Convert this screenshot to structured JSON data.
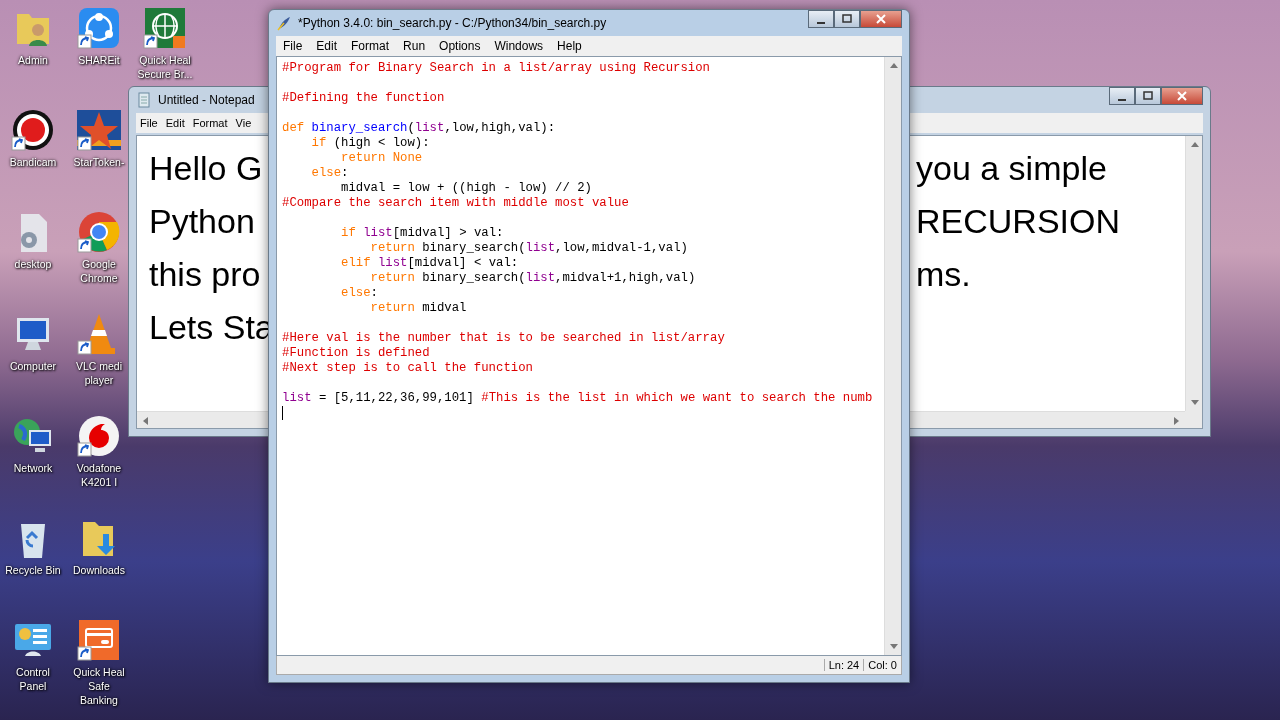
{
  "desktop_icons": [
    {
      "label": "Admin",
      "kind": "user-folder",
      "shortcut": false
    },
    {
      "label": "Bandicam",
      "kind": "record",
      "shortcut": true
    },
    {
      "label": "desktop",
      "kind": "document",
      "shortcut": false
    },
    {
      "label": "Computer",
      "kind": "computer",
      "shortcut": false
    },
    {
      "label": "Network",
      "kind": "network",
      "shortcut": false
    },
    {
      "label": "Recycle Bin",
      "kind": "recycle",
      "shortcut": false
    },
    {
      "label": "Control Panel",
      "kind": "control-panel",
      "shortcut": false
    },
    {
      "label": "SHAREit",
      "kind": "share",
      "shortcut": true
    },
    {
      "label": "StarToken-",
      "kind": "star",
      "shortcut": true
    },
    {
      "label": "Google Chrome",
      "kind": "browser",
      "shortcut": true
    },
    {
      "label": "VLC medi player",
      "kind": "cone",
      "shortcut": true
    },
    {
      "label": "Vodafone K4201 I",
      "kind": "vodafone",
      "shortcut": true
    },
    {
      "label": "Downloads",
      "kind": "download-folder",
      "shortcut": false
    },
    {
      "label": "Quick Heal Safe Banking",
      "kind": "card",
      "shortcut": true
    },
    {
      "label": "Quick Heal Secure Br...",
      "kind": "globe",
      "shortcut": true
    }
  ],
  "notepad": {
    "title": "Untitled - Notepad",
    "menu": [
      "File",
      "Edit",
      "Format",
      "Vie"
    ],
    "text_left": [
      "Hello G",
      "Python",
      "this pro",
      "Lets Sta"
    ],
    "text_right": [
      "you a simple",
      "RECURSION",
      "ms."
    ]
  },
  "editor": {
    "title": "*Python 3.4.0: bin_search.py - C:/Python34/bin_search.py",
    "menu": [
      "File",
      "Edit",
      "Format",
      "Run",
      "Options",
      "Windows",
      "Help"
    ],
    "lines": [
      {
        "kind": "code",
        "tokens": [
          {
            "kind": "comment",
            "text": "#Program for Binary Search in a list/array using Recursion"
          }
        ]
      },
      {
        "kind": "blank"
      },
      {
        "kind": "code",
        "tokens": [
          {
            "kind": "comment",
            "text": "#Defining the function"
          }
        ]
      },
      {
        "kind": "blank"
      },
      {
        "kind": "code",
        "tokens": [
          {
            "kind": "keyword",
            "text": "def "
          },
          {
            "kind": "definition",
            "text": "binary_search"
          },
          {
            "kind": "plain",
            "text": "("
          },
          {
            "kind": "builtin",
            "text": "list"
          },
          {
            "kind": "plain",
            "text": ",low,high,val):"
          }
        ]
      },
      {
        "kind": "code",
        "tokens": [
          {
            "kind": "keyword",
            "text": "    if"
          },
          {
            "kind": "plain",
            "text": " (high < low):"
          }
        ]
      },
      {
        "kind": "code",
        "tokens": [
          {
            "kind": "keyword",
            "text": "        return None"
          }
        ]
      },
      {
        "kind": "code",
        "tokens": [
          {
            "kind": "keyword",
            "text": "    else"
          },
          {
            "kind": "plain",
            "text": ":"
          }
        ]
      },
      {
        "kind": "code",
        "tokens": [
          {
            "kind": "plain",
            "text": "        midval = low + ((high - low) // 2)"
          }
        ]
      },
      {
        "kind": "code",
        "tokens": [
          {
            "kind": "comment",
            "text": "#Compare the search item with middle most value"
          }
        ]
      },
      {
        "kind": "blank"
      },
      {
        "kind": "code",
        "tokens": [
          {
            "kind": "keyword",
            "text": "        if "
          },
          {
            "kind": "builtin",
            "text": "list"
          },
          {
            "kind": "plain",
            "text": "[midval] > val:"
          }
        ]
      },
      {
        "kind": "code",
        "tokens": [
          {
            "kind": "keyword",
            "text": "            return "
          },
          {
            "kind": "plain",
            "text": "binary_search("
          },
          {
            "kind": "builtin",
            "text": "list"
          },
          {
            "kind": "plain",
            "text": ",low,midval-1,val)"
          }
        ]
      },
      {
        "kind": "code",
        "tokens": [
          {
            "kind": "keyword",
            "text": "        elif "
          },
          {
            "kind": "builtin",
            "text": "list"
          },
          {
            "kind": "plain",
            "text": "[midval] < val:"
          }
        ]
      },
      {
        "kind": "code",
        "tokens": [
          {
            "kind": "keyword",
            "text": "            return "
          },
          {
            "kind": "plain",
            "text": "binary_search("
          },
          {
            "kind": "builtin",
            "text": "list"
          },
          {
            "kind": "plain",
            "text": ",midval+1,high,val)"
          }
        ]
      },
      {
        "kind": "code",
        "tokens": [
          {
            "kind": "keyword",
            "text": "        else"
          },
          {
            "kind": "plain",
            "text": ":"
          }
        ]
      },
      {
        "kind": "code",
        "tokens": [
          {
            "kind": "keyword",
            "text": "            return "
          },
          {
            "kind": "plain",
            "text": "midval"
          }
        ]
      },
      {
        "kind": "blank"
      },
      {
        "kind": "code",
        "tokens": [
          {
            "kind": "comment",
            "text": "#Here val is the number that is to be searched in list/array"
          }
        ]
      },
      {
        "kind": "code",
        "tokens": [
          {
            "kind": "comment",
            "text": "#Function is defined"
          }
        ]
      },
      {
        "kind": "code",
        "tokens": [
          {
            "kind": "comment",
            "text": "#Next step is to call the function"
          }
        ]
      },
      {
        "kind": "blank"
      },
      {
        "kind": "code",
        "tokens": [
          {
            "kind": "builtin",
            "text": "list"
          },
          {
            "kind": "plain",
            "text": " = [5,11,22,36,99,101] "
          },
          {
            "kind": "comment",
            "text": "#This is the list in which we want to search the numb"
          }
        ]
      },
      {
        "kind": "cursor"
      }
    ],
    "status": {
      "line": "Ln: 24",
      "column": "Col: 0"
    }
  }
}
